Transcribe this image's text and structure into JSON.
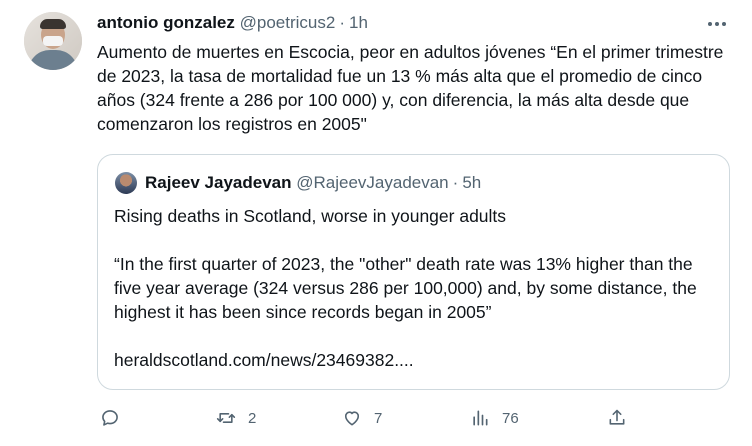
{
  "tweet": {
    "author_name": "antonio gonzalez",
    "author_handle": "@poetricus2",
    "separator": "·",
    "time": "1h",
    "text": "Aumento de muertes en Escocia, peor en adultos jóvenes “En el primer trimestre de 2023, la tasa de mortalidad fue un 13 % más alta que el promedio de cinco años (324 frente a 286 por 100 000) y, con diferencia, la más alta desde que comenzaron los registros en 2005\""
  },
  "quoted": {
    "author_name": "Rajeev Jayadevan",
    "author_handle": "@RajeevJayadevan",
    "separator": "·",
    "time": "5h",
    "line1": "Rising deaths in Scotland, worse in younger adults",
    "line2": "“In the first quarter of 2023, the \"other\" death rate was 13% higher than the five year average (324 versus 286 per 100,000) and, by some distance, the highest it has been since records began in 2005”",
    "link": "heraldscotland.com/news/23469382...."
  },
  "actions": {
    "reply_count": "",
    "retweet_count": "2",
    "like_count": "7",
    "view_count": "76"
  },
  "icons": {
    "more": "more-horizontal-icon",
    "reply": "reply-icon",
    "retweet": "retweet-icon",
    "like": "heart-icon",
    "views": "analytics-icon",
    "share": "share-icon"
  },
  "colors": {
    "text": "#0f1419",
    "secondary": "#536471",
    "border": "#cfd9de"
  }
}
